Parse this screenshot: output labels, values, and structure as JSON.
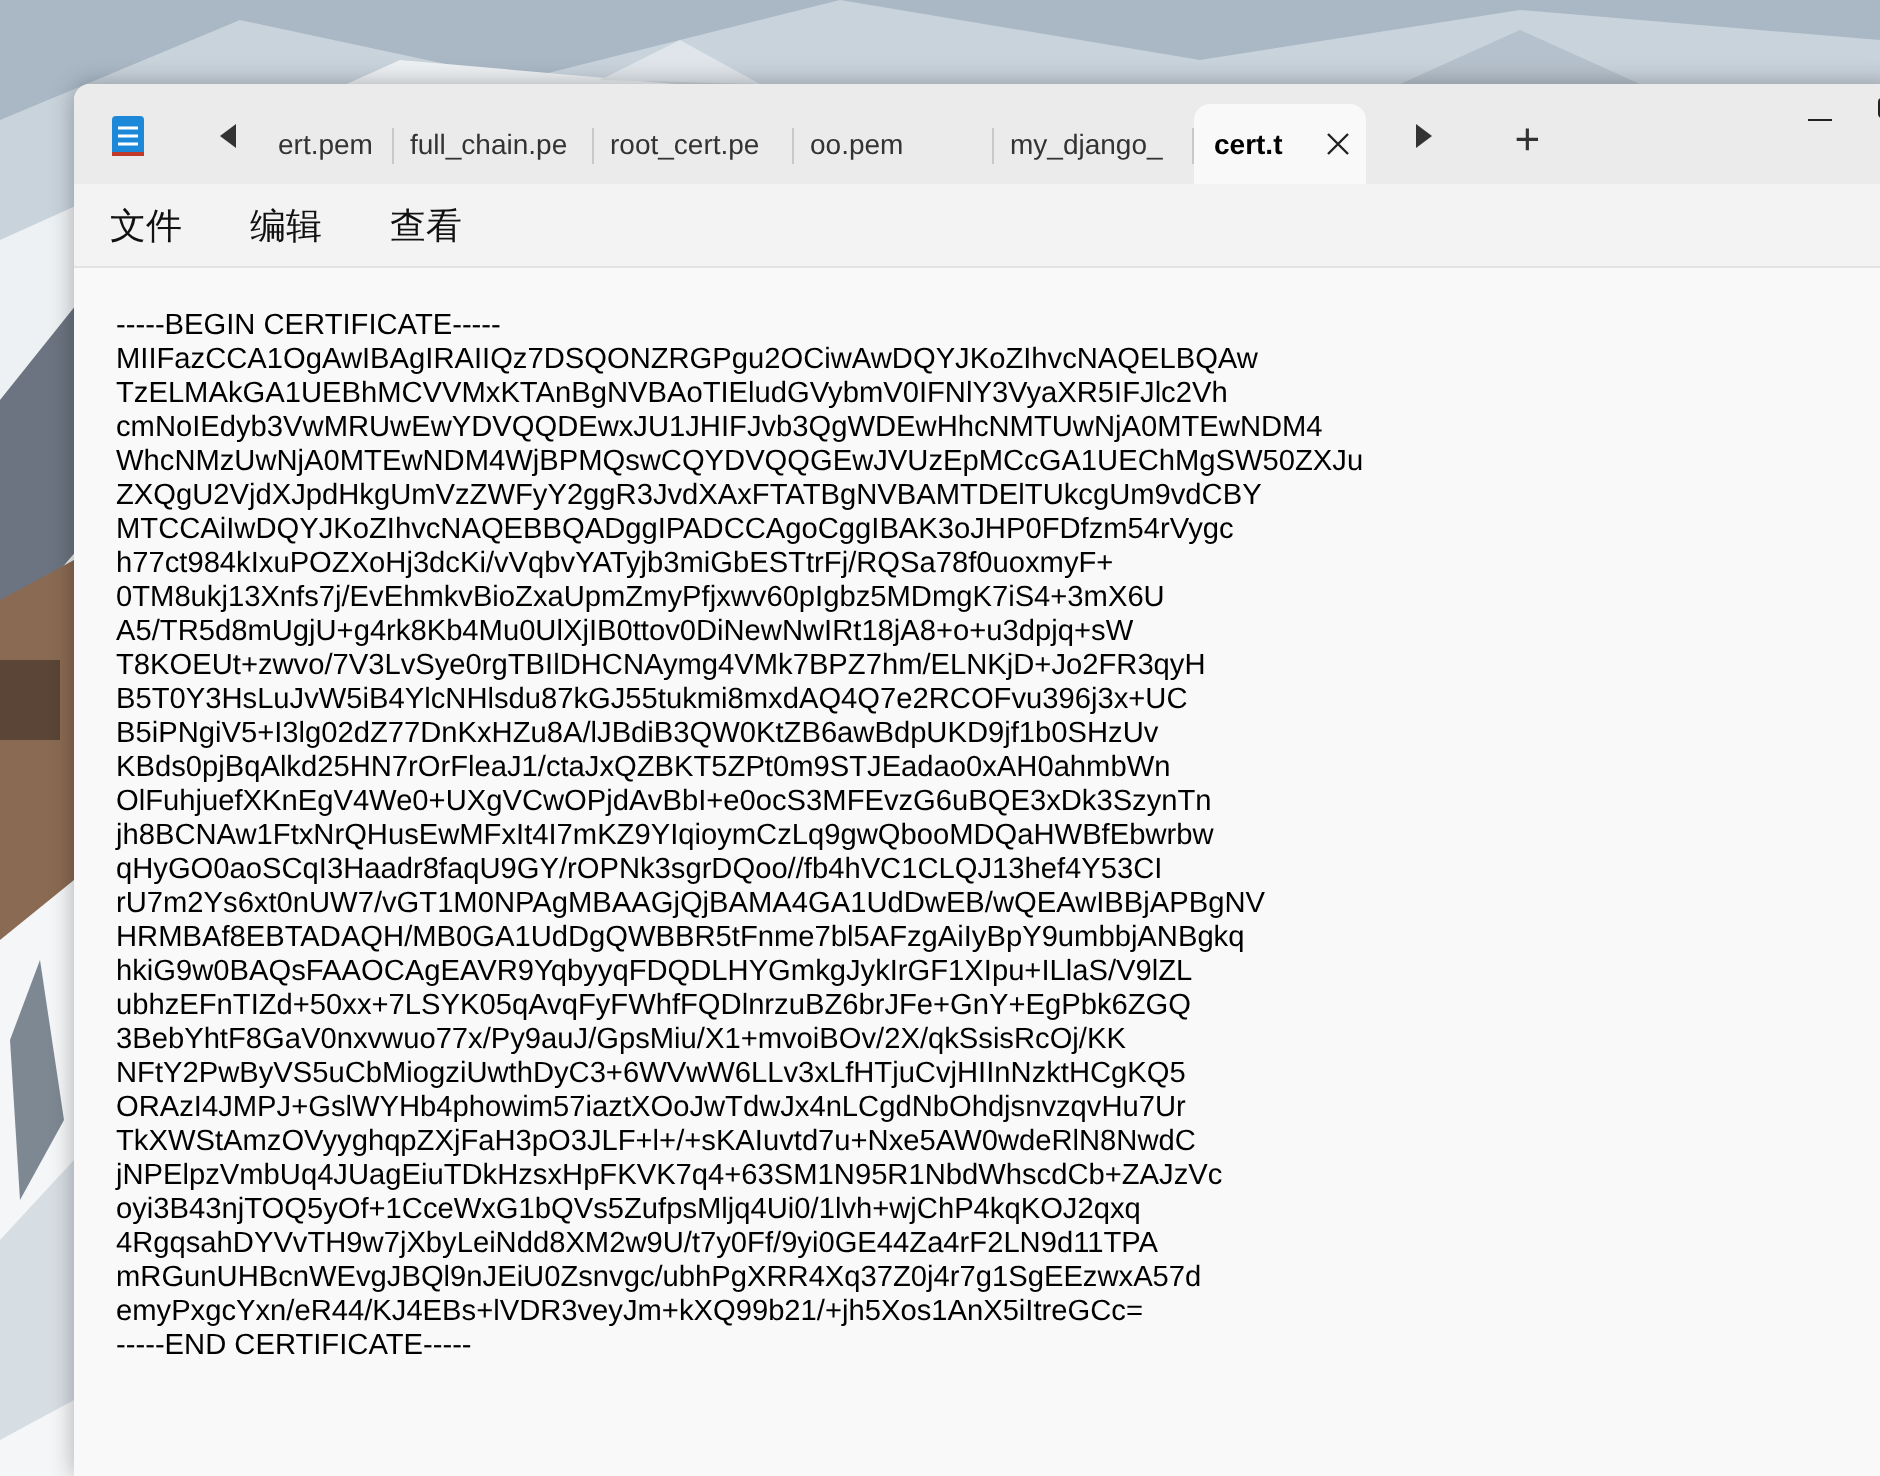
{
  "window": {
    "tabs": [
      {
        "label": "ert.pem",
        "selected": false
      },
      {
        "label": "full_chain.pe",
        "selected": false
      },
      {
        "label": "root_cert.pe",
        "selected": false
      },
      {
        "label": "oo.pem",
        "selected": false
      },
      {
        "label": "my_django_",
        "selected": false
      },
      {
        "label": "cert.t",
        "selected": true
      }
    ],
    "new_tab": "+"
  },
  "menu": [
    "文件",
    "编辑",
    "查看"
  ],
  "document": {
    "lines": [
      "-----BEGIN CERTIFICATE-----",
      "MIIFazCCA1OgAwIBAgIRAIIQz7DSQONZRGPgu2OCiwAwDQYJKoZIhvcNAQELBQAw",
      "TzELMAkGA1UEBhMCVVMxKTAnBgNVBAoTIEludGVybmV0IFNlY3VyaXR5IFJlc2Vh",
      "cmNoIEdyb3VwMRUwEwYDVQQDEwxJU1JHIFJvb3QgWDEwHhcNMTUwNjA0MTEwNDM4",
      "WhcNMzUwNjA0MTEwNDM4WjBPMQswCQYDVQQGEwJVUzEpMCcGA1UEChMgSW50ZXJu",
      "ZXQgU2VjdXJpdHkgUmVzZWFyY2ggR3JvdXAxFTATBgNVBAMTDElTUkcgUm9vdCBY",
      "MTCCAiIwDQYJKoZIhvcNAQEBBQADggIPADCCAgoCggIBAK3oJHP0FDfzm54rVygc",
      "h77ct984kIxuPOZXoHj3dcKi/vVqbvYATyjb3miGbESTtrFj/RQSa78f0uoxmyF+",
      "0TM8ukj13Xnfs7j/EvEhmkvBioZxaUpmZmyPfjxwv60pIgbz5MDmgK7iS4+3mX6U",
      "A5/TR5d8mUgjU+g4rk8Kb4Mu0UlXjIB0ttov0DiNewNwIRt18jA8+o+u3dpjq+sW",
      "T8KOEUt+zwvo/7V3LvSye0rgTBIlDHCNAymg4VMk7BPZ7hm/ELNKjD+Jo2FR3qyH",
      "B5T0Y3HsLuJvW5iB4YlcNHlsdu87kGJ55tukmi8mxdAQ4Q7e2RCOFvu396j3x+UC",
      "B5iPNgiV5+I3lg02dZ77DnKxHZu8A/lJBdiB3QW0KtZB6awBdpUKD9jf1b0SHzUv",
      "KBds0pjBqAlkd25HN7rOrFleaJ1/ctaJxQZBKT5ZPt0m9STJEadao0xAH0ahmbWn",
      "OlFuhjuefXKnEgV4We0+UXgVCwOPjdAvBbI+e0ocS3MFEvzG6uBQE3xDk3SzynTn",
      "jh8BCNAw1FtxNrQHusEwMFxIt4I7mKZ9YIqioymCzLq9gwQbooMDQaHWBfEbwrbw",
      "qHyGO0aoSCqI3Haadr8faqU9GY/rOPNk3sgrDQoo//fb4hVC1CLQJ13hef4Y53CI",
      "rU7m2Ys6xt0nUW7/vGT1M0NPAgMBAAGjQjBAMA4GA1UdDwEB/wQEAwIBBjAPBgNV",
      "HRMBAf8EBTADAQH/MB0GA1UdDgQWBBR5tFnme7bl5AFzgAiIyBpY9umbbjANBgkq",
      "hkiG9w0BAQsFAAOCAgEAVR9YqbyyqFDQDLHYGmkgJykIrGF1XIpu+ILlaS/V9lZL",
      "ubhzEFnTIZd+50xx+7LSYK05qAvqFyFWhfFQDlnrzuBZ6brJFe+GnY+EgPbk6ZGQ",
      "3BebYhtF8GaV0nxvwuo77x/Py9auJ/GpsMiu/X1+mvoiBOv/2X/qkSsisRcOj/KK",
      "NFtY2PwByVS5uCbMiogziUwthDyC3+6WVwW6LLv3xLfHTjuCvjHIInNzktHCgKQ5",
      "ORAzI4JMPJ+GslWYHb4phowim57iaztXOoJwTdwJx4nLCgdNbOhdjsnvzqvHu7Ur",
      "TkXWStAmzOVyyghqpZXjFaH3pO3JLF+l+/+sKAIuvtd7u+Nxe5AW0wdeRlN8NwdC",
      "jNPElpzVmbUq4JUagEiuTDkHzsxHpFKVK7q4+63SM1N95R1NbdWhscdCb+ZAJzVc",
      "oyi3B43njTOQ5yOf+1CceWxG1bQVs5ZufpsMljq4Ui0/1lvh+wjChP4kqKOJ2qxq",
      "4RgqsahDYVvTH9w7jXbyLeiNdd8XM2w9U/t7y0Ff/9yi0GE44Za4rF2LN9d11TPA",
      "mRGunUHBcnWEvgJBQl9nJEiU0Zsnvgc/ubhPgXRR4Xq37Z0j4r7g1SgEEzwxA57d",
      "emyPxgcYxn/eR44/KJ4EBs+lVDR3veyJm+kXQ99b21/+jh5Xos1AnX5iItreGCc=",
      "-----END CERTIFICATE-----"
    ]
  }
}
